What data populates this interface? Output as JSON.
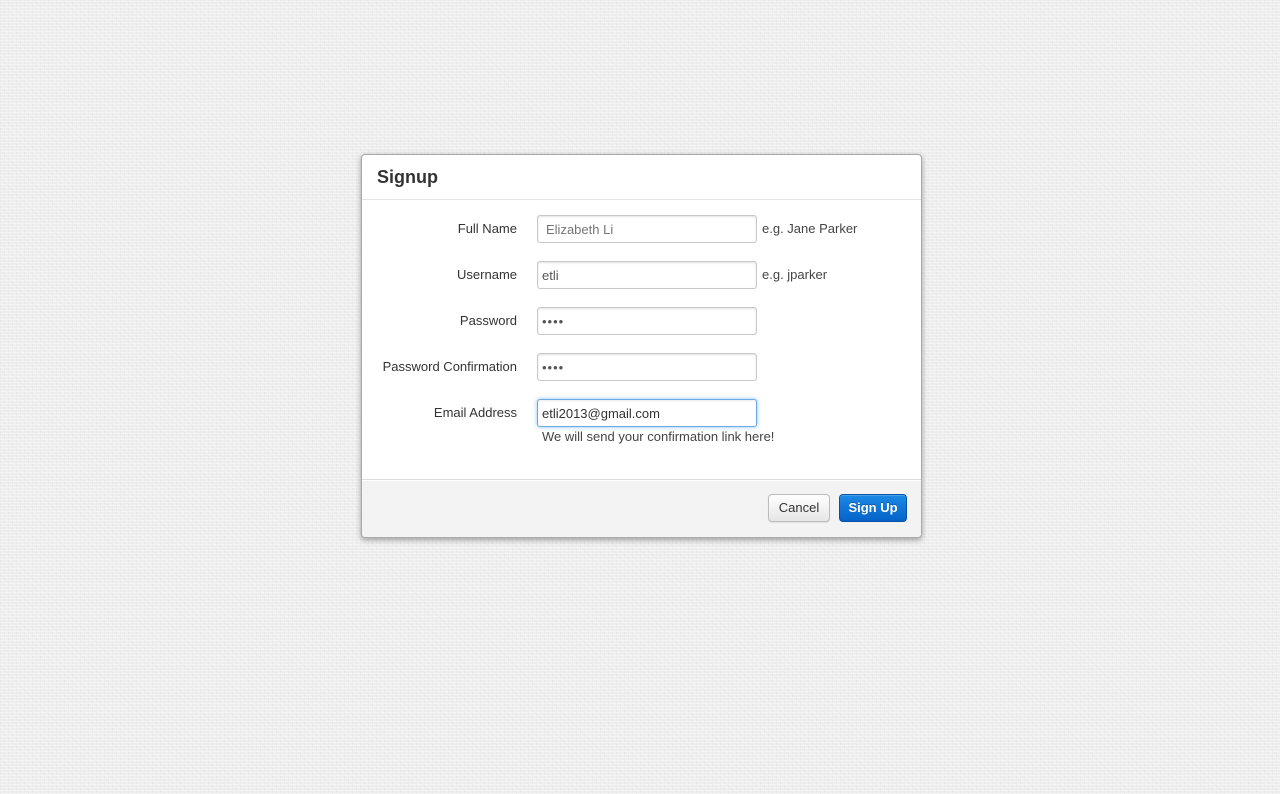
{
  "dialog": {
    "title": "Signup"
  },
  "form": {
    "full_name": {
      "label": "Full Name",
      "placeholder": "Elizabeth Li",
      "value": "",
      "hint": "e.g. Jane Parker"
    },
    "username": {
      "label": "Username",
      "value": "etli",
      "hint": "e.g. jparker"
    },
    "password": {
      "label": "Password",
      "value": "••••"
    },
    "password_confirmation": {
      "label": "Password Confirmation",
      "value": "••••"
    },
    "email": {
      "label": "Email Address",
      "value": "etli2013@gmail.com",
      "help": "We will send your confirmation link here!"
    }
  },
  "footer": {
    "cancel_label": "Cancel",
    "submit_label": "Sign Up"
  },
  "colors": {
    "primary": "#0a74d8",
    "focus_ring": "#6fa9e6",
    "background": "#efefef"
  }
}
